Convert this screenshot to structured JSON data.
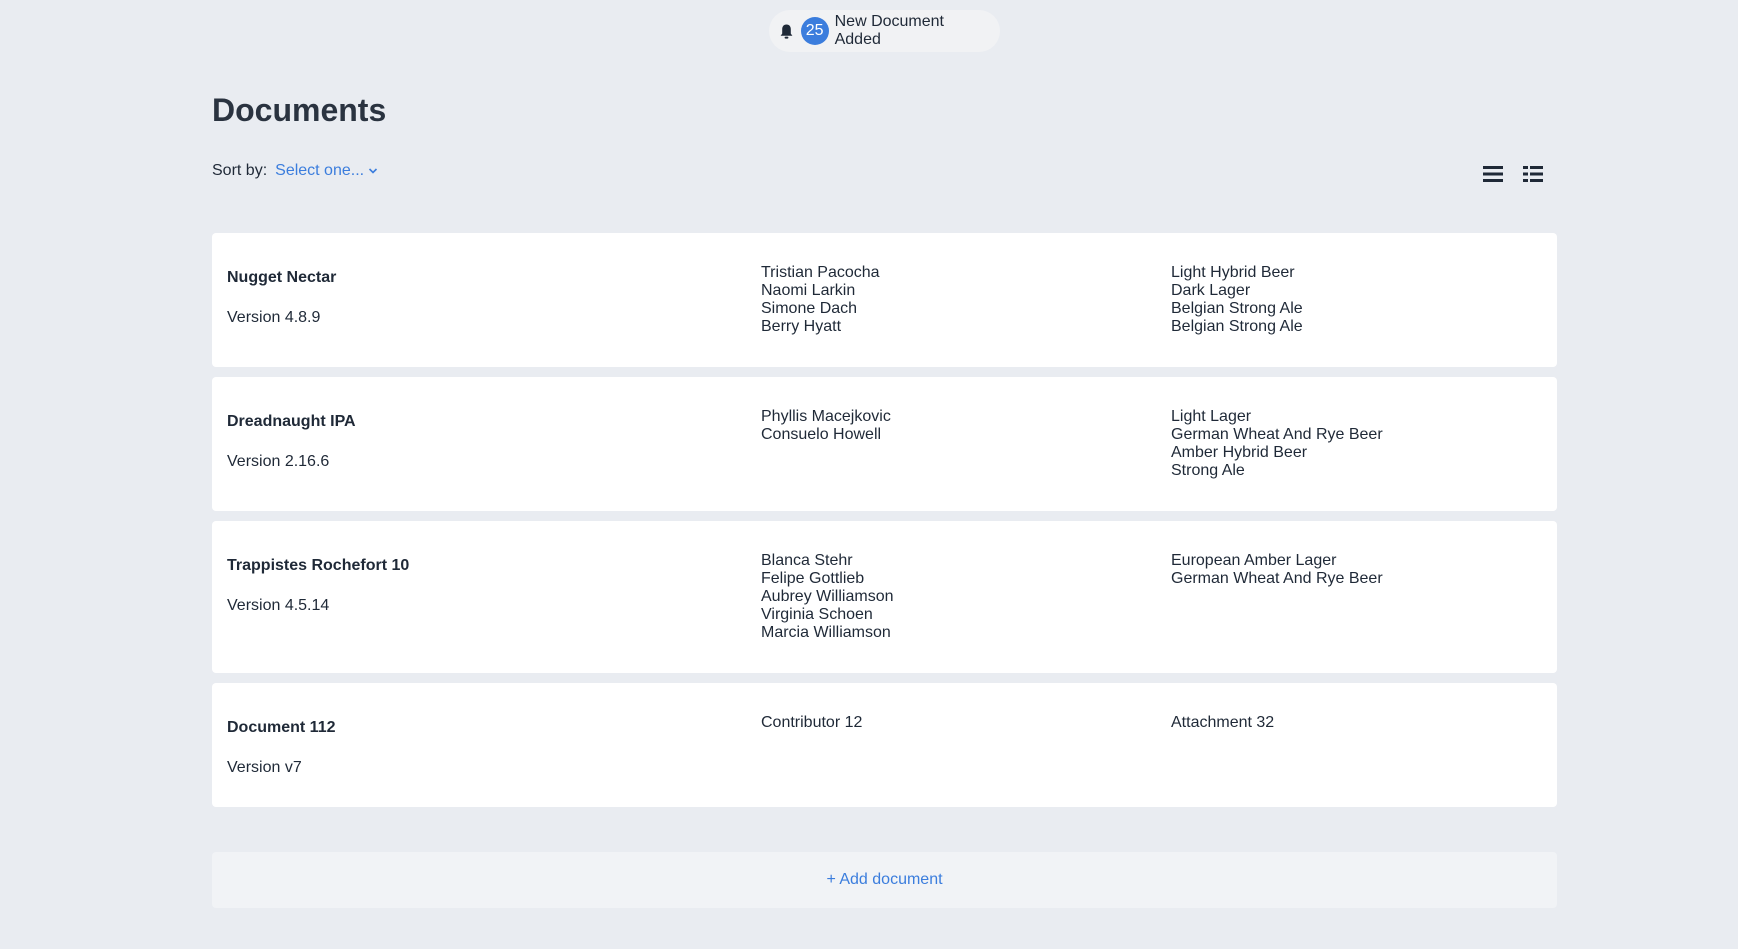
{
  "notification": {
    "count": "25",
    "message": "New Document Added",
    "icon": "bell-icon"
  },
  "page": {
    "title": "Documents"
  },
  "sort": {
    "label": "Sort by:",
    "selected": "Select one...",
    "icon": "chevron-down-icon"
  },
  "view_toggle": {
    "list_icon": "list-view-icon",
    "grid_icon": "grid-view-icon"
  },
  "documents": [
    {
      "name": "Nugget Nectar",
      "version": "Version 4.8.9",
      "contributors": [
        "Tristian Pacocha",
        "Naomi Larkin",
        "Simone Dach",
        "Berry Hyatt"
      ],
      "attachments": [
        "Light Hybrid Beer",
        "Dark Lager",
        "Belgian Strong Ale",
        "Belgian Strong Ale"
      ]
    },
    {
      "name": "Dreadnaught IPA",
      "version": "Version 2.16.6",
      "contributors": [
        "Phyllis Macejkovic",
        "Consuelo Howell"
      ],
      "attachments": [
        "Light Lager",
        "German Wheat And Rye Beer",
        "Amber Hybrid Beer",
        "Strong Ale"
      ]
    },
    {
      "name": "Trappistes Rochefort 10",
      "version": "Version 4.5.14",
      "contributors": [
        "Blanca Stehr",
        "Felipe Gottlieb",
        "Aubrey Williamson",
        "Virginia Schoen",
        "Marcia Williamson"
      ],
      "attachments": [
        "European Amber Lager",
        "German Wheat And Rye Beer"
      ]
    },
    {
      "name": "Document 112",
      "version": "Version v7",
      "contributors": [
        "Contributor 12"
      ],
      "attachments": [
        "Attachment 32"
      ]
    }
  ],
  "add_document": {
    "label": "+ Add document"
  }
}
